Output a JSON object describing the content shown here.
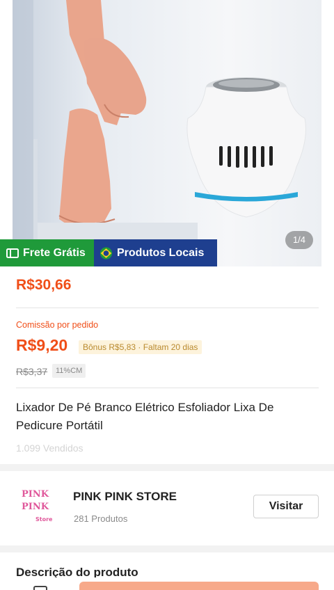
{
  "gallery": {
    "counter": "1/4"
  },
  "badges": {
    "free_shipping": "Frete Grátis",
    "local_products": "Produtos Locais"
  },
  "price": {
    "current": "R$30,66"
  },
  "commission": {
    "label": "Comissão por pedido",
    "value": "R$9,20",
    "bonus_tag": "Bônus R$5,83 · Faltam 20 dias",
    "original": "R$3,37",
    "rate_tag": "11%CM"
  },
  "product": {
    "title": "Lixador De Pé Branco Elétrico Esfoliador Lixa De Pedicure Portátil",
    "sold": "1.099 Vendidos"
  },
  "store": {
    "logo_line1": "PINK",
    "logo_line2": "PINK",
    "logo_line3": "Store",
    "name": "PINK PINK STORE",
    "count": "281 Produtos",
    "visit": "Visitar"
  },
  "description": {
    "title": "Descrição do produto"
  },
  "colors": {
    "accent": "#f04e18",
    "green_badge": "#1f9a3a",
    "blue_badge": "#1e3f8f",
    "cta": "#f7a98a"
  }
}
